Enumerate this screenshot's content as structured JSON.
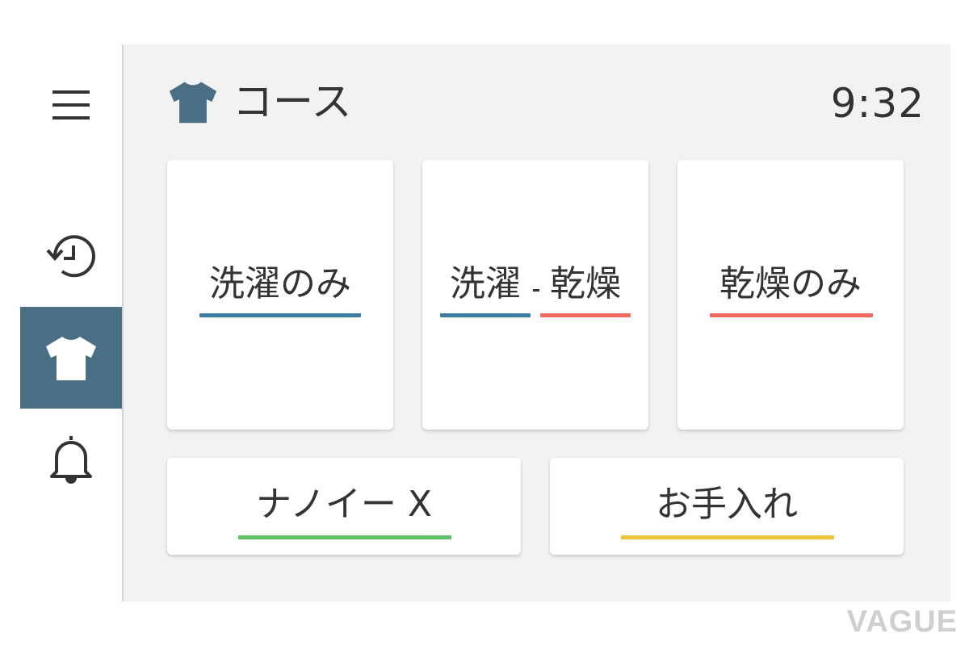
{
  "header": {
    "title": "コース",
    "time": "9:32",
    "icon": "shirt-icon"
  },
  "sidebar": {
    "items": [
      {
        "name": "menu",
        "icon": "hamburger-menu-icon",
        "active": false
      },
      {
        "name": "history",
        "icon": "history-icon",
        "active": false
      },
      {
        "name": "course",
        "icon": "shirt-icon",
        "active": true
      },
      {
        "name": "notifications",
        "icon": "bell-icon",
        "active": false
      }
    ]
  },
  "courses": {
    "wash_only": {
      "label": "洗濯のみ"
    },
    "wash_dry": {
      "label_wash": "洗濯",
      "label_dry": "乾燥"
    },
    "dry_only": {
      "label": "乾燥のみ"
    },
    "nanoe": {
      "label": "ナノイー X"
    },
    "care": {
      "label": "お手入れ"
    }
  },
  "colors": {
    "accent": "#4a6f85",
    "wash": "#3b7ea1",
    "dry": "#ee6a5f",
    "nanoe": "#5cc163",
    "care": "#eec23a",
    "background": "#f2f2f2",
    "card": "#ffffff"
  },
  "watermark": "VAGUE"
}
